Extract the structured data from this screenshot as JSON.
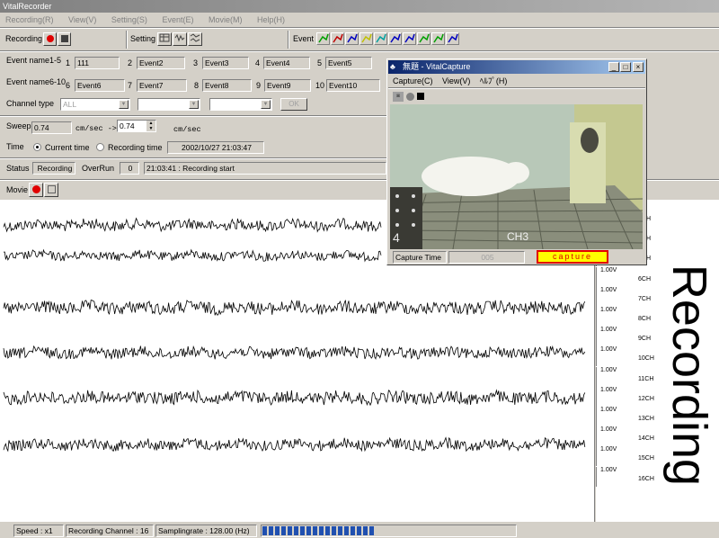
{
  "window": {
    "title": "VitalRecorder"
  },
  "menu": [
    "Recording(R)",
    "View(V)",
    "Setting(S)",
    "Event(E)",
    "Movie(M)",
    "Help(H)"
  ],
  "toolbar": {
    "recording_label": "Recording",
    "setting_label": "Setting",
    "event_label": "Event"
  },
  "event_colors": [
    "#00a000",
    "#c00000",
    "#0000c0",
    "#c0c000",
    "#00a0a0",
    "#0000c0",
    "#0000c0",
    "#00a000",
    "#00a000",
    "#0000c0"
  ],
  "events1": {
    "label": "Event name1-5",
    "items": [
      {
        "num": "1",
        "name": "111"
      },
      {
        "num": "2",
        "name": "Event2"
      },
      {
        "num": "3",
        "name": "Event3"
      },
      {
        "num": "4",
        "name": "Event4"
      },
      {
        "num": "5",
        "name": "Event5"
      }
    ]
  },
  "events2": {
    "label": "Event name6-10",
    "items": [
      {
        "num": "6",
        "name": "Event6"
      },
      {
        "num": "7",
        "name": "Event7"
      },
      {
        "num": "8",
        "name": "Event8"
      },
      {
        "num": "9",
        "name": "Event9"
      },
      {
        "num": "10",
        "name": "Event10"
      }
    ]
  },
  "channel_type": {
    "label": "Channel type",
    "value": "ALL",
    "ok_label": "OK"
  },
  "sweep": {
    "label": "Sweep",
    "value1": "0.74",
    "unit_arrow": "cm/sec ->",
    "value2": "0.74",
    "unit2": "cm/sec"
  },
  "time": {
    "label": "Time",
    "opt_current": "Current time",
    "opt_recording": "Recording time",
    "value": "2002/10/27 21:03:47"
  },
  "status": {
    "label": "Status",
    "value": "Recording",
    "overrun_label": "OverRun",
    "overrun_value": "0",
    "message": "21:03:41 : Recording start"
  },
  "movie": {
    "label": "Movie"
  },
  "scale": {
    "entries": [
      {
        "v": "1.00V",
        "ch": "3CH"
      },
      {
        "v": "1.00V",
        "ch": "4CH"
      },
      {
        "v": "1.00V",
        "ch": "5CH"
      },
      {
        "v": "1.00V",
        "ch": "6CH"
      },
      {
        "v": "1.00V",
        "ch": "7CH"
      },
      {
        "v": "1.00V",
        "ch": "8CH"
      },
      {
        "v": "1.00V",
        "ch": "9CH"
      },
      {
        "v": "1.00V",
        "ch": "10CH"
      },
      {
        "v": "1.00V",
        "ch": "11CH"
      },
      {
        "v": "1.00V",
        "ch": "12CH"
      },
      {
        "v": "1.00V",
        "ch": "13CH"
      },
      {
        "v": "1.00V",
        "ch": "14CH"
      },
      {
        "v": "1.00V",
        "ch": "15CH"
      },
      {
        "v": "1.00V",
        "ch": "16CH"
      }
    ]
  },
  "overlay": {
    "text": "Recording"
  },
  "statusbar": {
    "speed": "Speed : x1",
    "channel": "Recording Channel :  16",
    "rate": "Samplingrate : 128.00 (Hz)",
    "progress": 0.45
  },
  "capture": {
    "title": "無題 - VitalCapture",
    "menu": [
      "Capture(C)",
      "View(V)",
      "ﾍﾙﾌﾟ(H)"
    ],
    "time_label": "Capture Time",
    "time_value": "005",
    "capture_label": "capture",
    "video_text_ch": "CH3",
    "video_text_num": "4"
  }
}
